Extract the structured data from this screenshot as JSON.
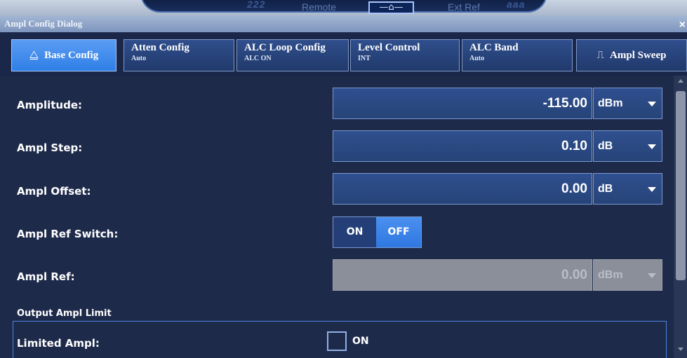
{
  "statusbar": {
    "remote": "Remote",
    "ext_ref": "Ext Ref",
    "home_glyph": "—⌂—",
    "deco_left": "222",
    "deco_right": "aaa"
  },
  "dialog": {
    "title": "Ampl Config Dialog",
    "close_glyph": "×"
  },
  "tabs": [
    {
      "label": "Base Config",
      "sub": "",
      "icon": "triangle-icon",
      "glyph": "⧋",
      "active": true
    },
    {
      "label": "Atten Config",
      "sub": "Auto",
      "active": false
    },
    {
      "label": "ALC Loop Config",
      "sub": "ALC ON",
      "active": false
    },
    {
      "label": "Level Control",
      "sub": "INT",
      "active": false
    },
    {
      "label": "ALC Band",
      "sub": "Auto",
      "active": false
    },
    {
      "label": "Ampl Sweep",
      "sub": "",
      "icon": "sweep-icon",
      "glyph": "⎍",
      "active": false
    }
  ],
  "fields": {
    "amplitude": {
      "label": "Amplitude:",
      "value": "-115.00",
      "unit": "dBm"
    },
    "ampl_step": {
      "label": "Ampl Step:",
      "value": "0.10",
      "unit": "dB"
    },
    "ampl_offset": {
      "label": "Ampl Offset:",
      "value": "0.00",
      "unit": "dB"
    },
    "ampl_ref_switch": {
      "label": "Ampl Ref Switch:",
      "on_label": "ON",
      "off_label": "OFF",
      "selected": "OFF"
    },
    "ampl_ref": {
      "label": "Ampl Ref:",
      "value": "0.00",
      "unit": "dBm",
      "disabled": true
    }
  },
  "output_limit": {
    "section_label": "Output Ampl Limit",
    "limited_ampl_label": "Limited Ampl:",
    "checkbox_label": "ON",
    "checked": false
  },
  "colors": {
    "accent": "#2f7fe6",
    "panel_bg": "#1e2a4a",
    "field_bg": "#264478",
    "disabled": "#8a8f99"
  }
}
